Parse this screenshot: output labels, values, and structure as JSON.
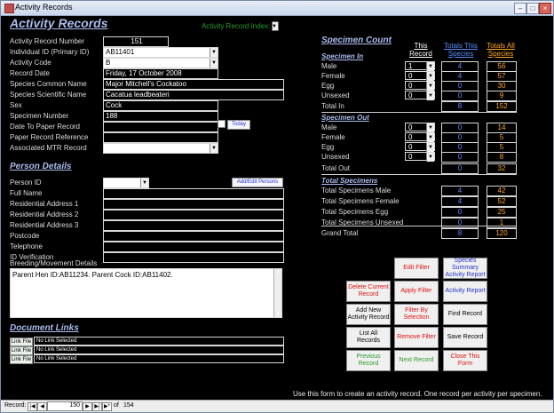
{
  "window": {
    "title": "Activity Records"
  },
  "header": {
    "title": "Activity Records",
    "index_label": "Activity Record Index:"
  },
  "fields": [
    {
      "label": "Activity Record Number",
      "value": "151"
    },
    {
      "label": "Individual ID (Primary ID)",
      "value": "AB11401"
    },
    {
      "label": "Activity Code",
      "value": "B"
    },
    {
      "label": "Record Date",
      "value": "Friday, 17 October 2008"
    },
    {
      "label": "Species Common Name",
      "value": "Major Mitchell's Cockatoo"
    },
    {
      "label": "Species Scientific Name",
      "value": "Cacatua leadbeateri"
    },
    {
      "label": "Sex",
      "value": "Cock"
    },
    {
      "label": "Specimen Number",
      "value": "188"
    },
    {
      "label": "Date To Paper Record",
      "value": ""
    },
    {
      "label": "Paper Record Reference",
      "value": ""
    },
    {
      "label": "Associated MTR Record",
      "value": ""
    }
  ],
  "today_label": "Today",
  "person": {
    "title": "Person Details",
    "add_edit_label": "Add/Edit Persons",
    "fields": [
      {
        "label": "Person ID",
        "value": ""
      },
      {
        "label": "Full Name",
        "value": ""
      },
      {
        "label": "Residential Address 1",
        "value": ""
      },
      {
        "label": "Residential Address 2",
        "value": ""
      },
      {
        "label": "Residential Address 3",
        "value": ""
      },
      {
        "label": "Postcode",
        "value": ""
      },
      {
        "label": "Telephone",
        "value": ""
      },
      {
        "label": "ID Verification",
        "value": ""
      }
    ],
    "breeding_label": "Breeding/Movement Details",
    "breeding_text": "Parent Hen ID:AB11234. Parent Cock ID:AB11402."
  },
  "documents": {
    "title": "Document Links",
    "items": [
      {
        "button": "Link File",
        "text": "No Link Selected"
      },
      {
        "button": "Link File",
        "text": "No Link Selected"
      },
      {
        "button": "Link File",
        "text": "No Link Selected"
      }
    ]
  },
  "specimen": {
    "title": "Specimen Count",
    "col_this": "This Record",
    "col_species": "Totals This Species",
    "col_all": "Totals All Species",
    "in": {
      "title": "Specimen In",
      "rows": [
        {
          "label": "Male",
          "this": "1",
          "species": "4",
          "all": "56"
        },
        {
          "label": "Female",
          "this": "0",
          "species": "4",
          "all": "57"
        },
        {
          "label": "Egg",
          "this": "0",
          "species": "0",
          "all": "30"
        },
        {
          "label": "Unsexed",
          "this": "0",
          "species": "0",
          "all": "9"
        }
      ],
      "total_label": "Total In",
      "total_species": "8",
      "total_all": "152"
    },
    "out": {
      "title": "Specimen Out",
      "rows": [
        {
          "label": "Male",
          "this": "0",
          "species": "0",
          "all": "14"
        },
        {
          "label": "Female",
          "this": "0",
          "species": "0",
          "all": "5"
        },
        {
          "label": "Egg",
          "this": "0",
          "species": "0",
          "all": "5"
        },
        {
          "label": "Unsexed",
          "this": "0",
          "species": "0",
          "all": "8"
        }
      ],
      "total_label": "Total Out",
      "total_species": "0",
      "total_all": "32"
    },
    "totals": {
      "title": "Total Specimens",
      "rows": [
        {
          "label": "Total Specimens Male",
          "species": "4",
          "all": "42"
        },
        {
          "label": "Total Specimens Female",
          "species": "4",
          "all": "52"
        },
        {
          "label": "Total Specimens Egg",
          "species": "0",
          "all": "25"
        },
        {
          "label": "Total Specimens Unsexed",
          "species": "0",
          "all": "1"
        }
      ],
      "grand_label": "Grand Total",
      "grand_species": "8",
      "grand_all": "120"
    }
  },
  "buttons": {
    "edit_filter": "Edit Filter",
    "species_summary": "Species Summary Activity Report",
    "delete_current": "Delete Current Record",
    "apply_filter": "Apply Filter",
    "activity_report": "Activity Report",
    "add_new": "Add New Activity Record",
    "filter_by_selection": "Filter By Selection",
    "find_record": "Find Record",
    "list_all": "List All Records",
    "remove_filter": "Remove Filter",
    "save_record": "Save Record",
    "previous": "Previous Record",
    "next": "Next Record",
    "close_form": "Close This Form"
  },
  "footer_note": "Use this form to create an activity record. One record per activity per specimen.",
  "nav": {
    "record_label": "Record:",
    "current": "150",
    "of_label": "of",
    "total": "154"
  },
  "colors": {
    "label_blue": "#5a8dff",
    "label_orange": "#ffa726",
    "red_text": "#d11",
    "green_text": "#2a9a2a",
    "blue_text": "#2233cc"
  }
}
